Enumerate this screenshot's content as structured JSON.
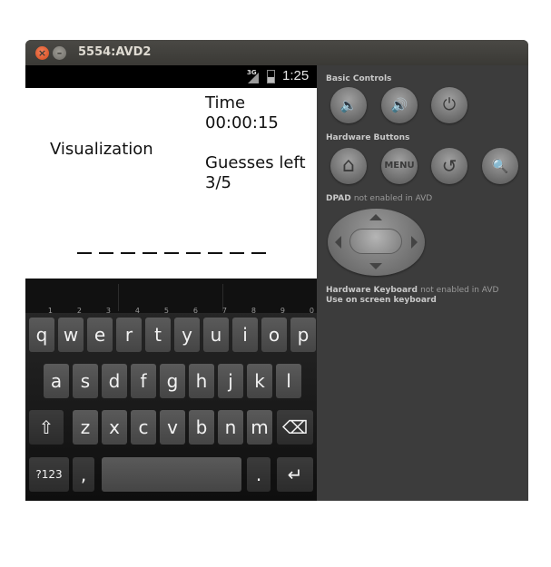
{
  "window": {
    "title": "5554:AVD2",
    "close_glyph": "×",
    "min_glyph": "–"
  },
  "status_bar": {
    "network": "3G",
    "time": "1:25"
  },
  "app": {
    "heading": "Visualization",
    "time_label": "Time",
    "time_value": "00:00:15",
    "guesses_label": "Guesses left",
    "guesses_value": "3/5",
    "blank_count": 9
  },
  "keyboard": {
    "row1": [
      {
        "key": "q",
        "hint": "1"
      },
      {
        "key": "w",
        "hint": "2"
      },
      {
        "key": "e",
        "hint": "3"
      },
      {
        "key": "r",
        "hint": "4"
      },
      {
        "key": "t",
        "hint": "5"
      },
      {
        "key": "y",
        "hint": "6"
      },
      {
        "key": "u",
        "hint": "7"
      },
      {
        "key": "i",
        "hint": "8"
      },
      {
        "key": "o",
        "hint": "9"
      },
      {
        "key": "p",
        "hint": "0"
      }
    ],
    "row2": [
      "a",
      "s",
      "d",
      "f",
      "g",
      "h",
      "j",
      "k",
      "l"
    ],
    "row3": [
      "z",
      "x",
      "c",
      "v",
      "b",
      "n",
      "m"
    ],
    "shift_glyph": "⇧",
    "delete_glyph": "⌫",
    "symbols_label": "?123",
    "comma_label": ",",
    "period_label": ".",
    "enter_glyph": "↵"
  },
  "panel": {
    "basic_controls": "Basic Controls",
    "hardware_buttons": "Hardware Buttons",
    "dpad_label": "DPAD",
    "dpad_note": "not enabled in AVD",
    "hw_keyboard_label": "Hardware Keyboard",
    "hw_keyboard_note": "not enabled in AVD",
    "use_onscreen": "Use on screen keyboard",
    "menu_label": "MENU",
    "icons": {
      "volume_down": "🔈",
      "volume_up": "🔊",
      "power": "⏻",
      "home": "⌂",
      "back": "↺",
      "search": "🔍"
    }
  }
}
